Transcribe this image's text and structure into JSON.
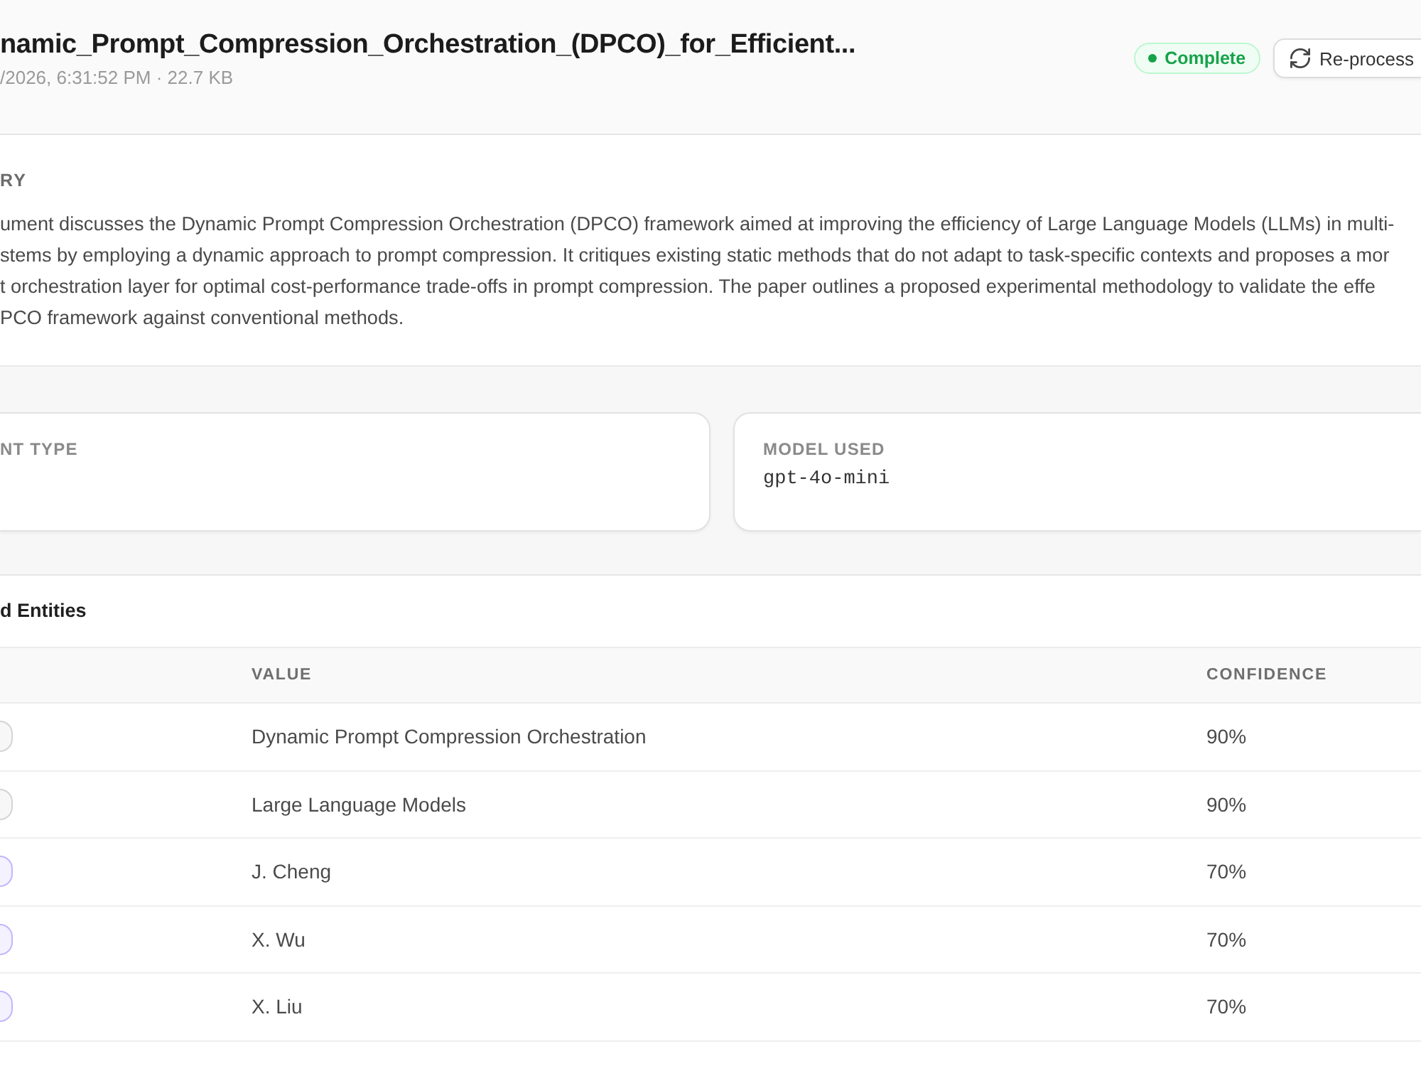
{
  "header": {
    "title": "namic_Prompt_Compression_Orchestration_(DPCO)_for_Efficient...",
    "meta": "/2026, 6:31:52 PM · 22.7 KB",
    "status": {
      "label": "Complete",
      "kind": "success"
    },
    "reprocess_button": "Re-process"
  },
  "summary": {
    "heading": "RY",
    "lines": [
      "ument discusses the Dynamic Prompt Compression Orchestration (DPCO) framework aimed at improving the efficiency of Large Language Models (LLMs) in multi-",
      "stems by employing a dynamic approach to prompt compression. It critiques existing static methods that do not adapt to task-specific contexts and proposes a mor",
      "t orchestration layer for optimal cost-performance trade-offs in prompt compression. The paper outlines a proposed experimental methodology to validate the effe",
      "PCO framework against conventional methods."
    ]
  },
  "info_cards": [
    {
      "label": "NT TYPE"
    },
    {
      "label": "MODEL USED",
      "value": "gpt-4o-mini"
    }
  ],
  "entities": {
    "heading": "d Entities",
    "columns": [
      "VALUE",
      "CONFIDENCE"
    ],
    "rows": [
      {
        "color": "#d4d4d8",
        "value": "Dynamic Prompt Compression Orchestration",
        "confidence": "90%"
      },
      {
        "color": "#d4d4d8",
        "value": "Large Language Models",
        "confidence": "90%"
      },
      {
        "color": "#c4b5fd",
        "value": "J. Cheng",
        "confidence": "70%"
      },
      {
        "color": "#c4b5fd",
        "value": "X. Wu",
        "confidence": "70%"
      },
      {
        "color": "#c4b5fd",
        "value": "X. Liu",
        "confidence": "70%"
      }
    ]
  }
}
